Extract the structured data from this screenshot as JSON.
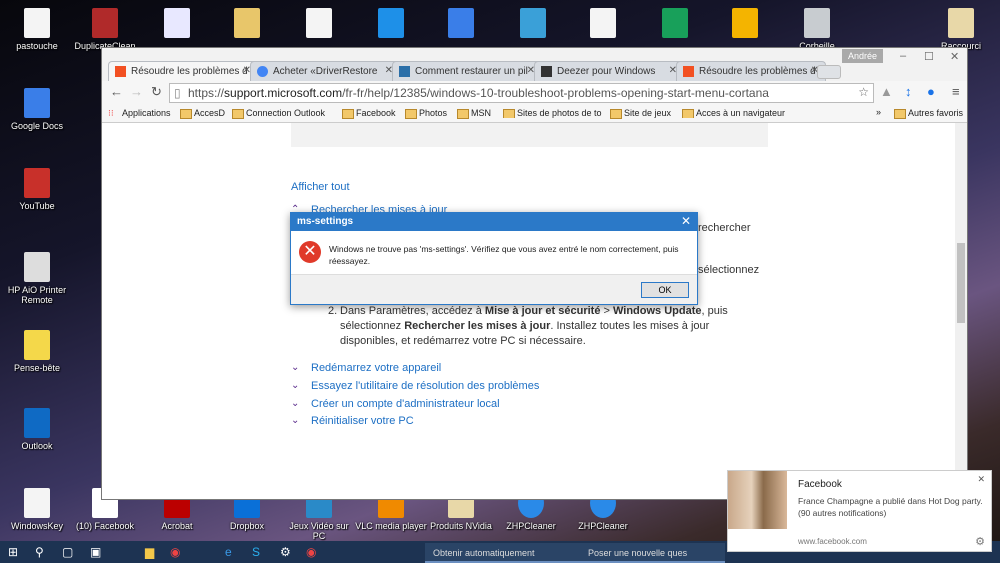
{
  "desktop": {
    "icons_top": [
      "pastouche",
      "DuplicateClean",
      "",
      "",
      "",
      "",
      "",
      "",
      "",
      "",
      "",
      "",
      "Corbeille",
      "",
      "Raccourci"
    ],
    "icons_left": [
      "Google Docs",
      "YouTube",
      "HP AiO Printer Remote",
      "Pense-bête",
      "Outlook",
      "WindowsKey"
    ],
    "icons_bottom": [
      "(10) Facebook",
      "Acrobat",
      "Dropbox",
      "Jeux Vidéo sur PC",
      "VLC media player",
      "Produits NVidia",
      "ZHPCleaner",
      "ZHPCleaner"
    ]
  },
  "browser": {
    "user": "Andrée",
    "tabs": [
      {
        "label": "Résoudre les problèmes d",
        "active": true,
        "color": "#f25022"
      },
      {
        "label": "Acheter «DriverRestore",
        "color": "#4285f4"
      },
      {
        "label": "Comment restaurer un pil",
        "color": "#2b6fa8"
      },
      {
        "label": "Deezer pour Windows",
        "color": "#333333"
      },
      {
        "label": "Résoudre les problèmes d",
        "color": "#f25022"
      }
    ],
    "url_scheme": "https://",
    "url_host": "support.microsoft.com",
    "url_path": "/fr-fr/help/12385/windows-10-troubleshoot-problems-opening-start-menu-cortana",
    "bookmarks": [
      "AccesD",
      "Connection Outlook",
      "Facebook",
      "Photos",
      "MSN",
      "Sites de photos de to",
      "Site de jeux",
      "Acces à un navigateur"
    ],
    "apps_label": "Applications",
    "more": "»",
    "other_bookmarks": "Autres favoris"
  },
  "page": {
    "show_all": "Afficher tout",
    "section_open": "Rechercher les mises à jour",
    "partial1": "rechercher",
    "partial2": "sélectionnez",
    "step2": {
      "num": "2.",
      "t1": "Dans Paramètres, accédez à ",
      "b1": "Mise à jour et sécurité",
      "sep": " > ",
      "b2": "Windows Update",
      "t2": ", puis sélectionnez ",
      "b3": "Rechercher les mises à jour",
      "t3": ". Installez toutes les mises à jour disponibles, et redémarrez votre PC si nécessaire."
    },
    "sections": [
      "Redémarrez votre appareil",
      "Essayez l'utilitaire de résolution des problèmes",
      "Créer un compte d'administrateur local",
      "Réinitialiser votre PC"
    ]
  },
  "dialog": {
    "title": "ms-settings",
    "message": "Windows ne trouve pas 'ms-settings'. Vérifiez que vous avez entré le nom correctement, puis réessayez.",
    "ok": "OK",
    "accent": "#2b79c8"
  },
  "notification": {
    "title": "Facebook",
    "body": "France Champagne a publié dans Hot Dog party.",
    "extra": "(90 autres notifications)",
    "source": "www.facebook.com"
  },
  "taskbar": {
    "windows": [
      "Obtenir automatiquement",
      "Poser une nouvelle ques"
    ]
  }
}
